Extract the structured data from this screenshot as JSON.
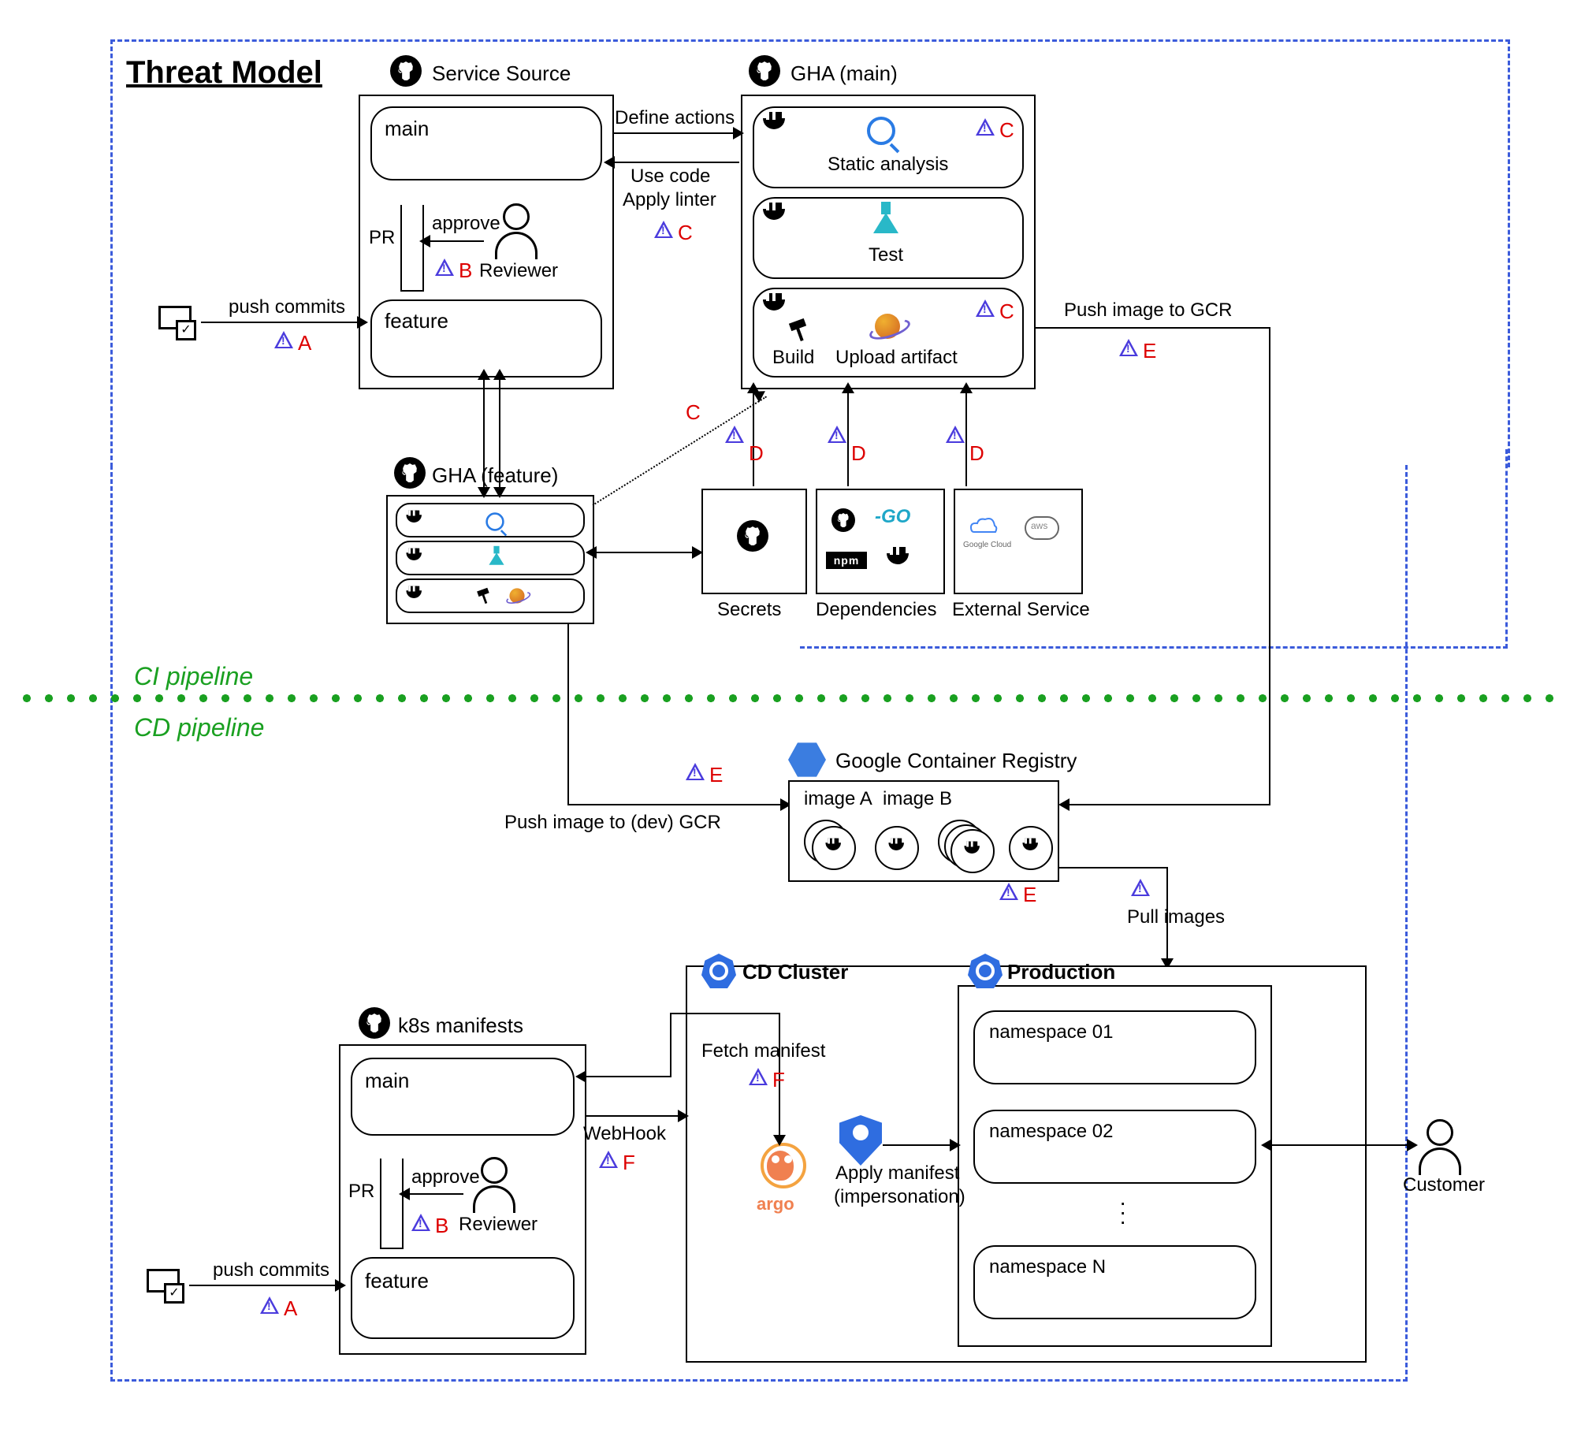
{
  "title": "Threat Model",
  "sections": {
    "ci": "CI pipeline",
    "cd": "CD pipeline"
  },
  "boxes": {
    "service_source": "Service Source",
    "gha_main": "GHA (main)",
    "gha_feature": "GHA (feature)",
    "secrets": "Secrets",
    "dependencies": "Dependencies",
    "external_service": "External Service",
    "gcr": "Google Container Registry",
    "cd_cluster": "CD Cluster",
    "production": "Production",
    "k8s_manifests": "k8s manifests"
  },
  "branches": {
    "main": "main",
    "feature": "feature"
  },
  "roles": {
    "reviewer": "Reviewer",
    "customer": "Customer"
  },
  "jobs": {
    "static_analysis": "Static analysis",
    "test": "Test",
    "build": "Build",
    "upload_artifact": "Upload artifact"
  },
  "edges": {
    "push_commits": "push commits",
    "pr": "PR",
    "approve": "approve",
    "define_actions": "Define actions",
    "use_code": "Use code",
    "apply_linter": "Apply linter",
    "push_image_gcr": "Push image to GCR",
    "push_image_dev_gcr": "Push image to (dev) GCR",
    "pull_images": "Pull images",
    "fetch_manifest": "Fetch manifest",
    "webhook": "WebHook",
    "apply_manifest": "Apply manifest",
    "impersonation": "(impersonation)"
  },
  "gcr_images": {
    "a": "image A",
    "b": "image B"
  },
  "namespaces": {
    "n1": "namespace 01",
    "n2": "namespace 02",
    "nn": "namespace N"
  },
  "threats": {
    "A": "A",
    "B": "B",
    "C": "C",
    "D": "D",
    "E": "E",
    "F": "F"
  }
}
